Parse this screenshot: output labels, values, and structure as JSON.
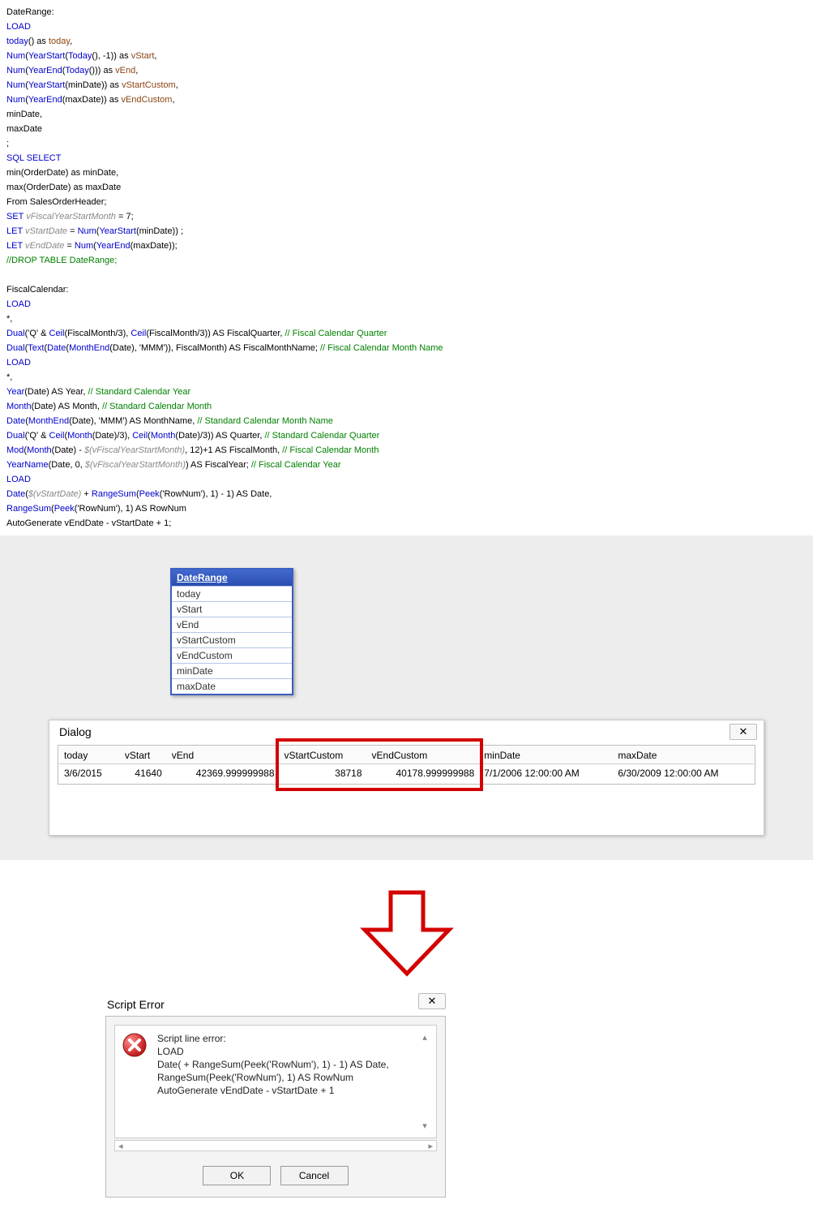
{
  "code": {
    "lines": [
      {
        "parts": [
          {
            "t": "DateRange:",
            "c": "c-black"
          }
        ]
      },
      {
        "parts": [
          {
            "t": "LOAD",
            "c": "c-blue"
          }
        ]
      },
      {
        "parts": [
          {
            "t": "today",
            "c": "c-blue"
          },
          {
            "t": "() as ",
            "c": "c-black"
          },
          {
            "t": "today",
            "c": "c-brown"
          },
          {
            "t": ",",
            "c": "c-black"
          }
        ]
      },
      {
        "parts": [
          {
            "t": "Num",
            "c": "c-blue"
          },
          {
            "t": "(",
            "c": "c-black"
          },
          {
            "t": "YearStart",
            "c": "c-blue"
          },
          {
            "t": "(",
            "c": "c-black"
          },
          {
            "t": "Today",
            "c": "c-blue"
          },
          {
            "t": "(), -1)) as ",
            "c": "c-black"
          },
          {
            "t": "vStart",
            "c": "c-brown"
          },
          {
            "t": ",",
            "c": "c-black"
          }
        ]
      },
      {
        "parts": [
          {
            "t": " Num",
            "c": "c-blue"
          },
          {
            "t": "(",
            "c": "c-black"
          },
          {
            "t": "YearEnd",
            "c": "c-blue"
          },
          {
            "t": "(",
            "c": "c-black"
          },
          {
            "t": "Today",
            "c": "c-blue"
          },
          {
            "t": "())) as ",
            "c": "c-black"
          },
          {
            "t": "vEnd",
            "c": "c-brown"
          },
          {
            "t": ",",
            "c": "c-black"
          }
        ]
      },
      {
        "parts": [
          {
            "t": "Num",
            "c": "c-blue"
          },
          {
            "t": "(",
            "c": "c-black"
          },
          {
            "t": "YearStart",
            "c": "c-blue"
          },
          {
            "t": "(minDate)) as ",
            "c": "c-black"
          },
          {
            "t": "vStartCustom",
            "c": "c-brown"
          },
          {
            "t": ",",
            "c": "c-black"
          }
        ]
      },
      {
        "parts": [
          {
            "t": "Num",
            "c": "c-blue"
          },
          {
            "t": "(",
            "c": "c-black"
          },
          {
            "t": "YearEnd",
            "c": "c-blue"
          },
          {
            "t": "(maxDate)) as ",
            "c": "c-black"
          },
          {
            "t": "vEndCustom",
            "c": "c-brown"
          },
          {
            "t": ",",
            "c": "c-black"
          }
        ]
      },
      {
        "parts": [
          {
            "t": " minDate,",
            "c": "c-black"
          }
        ]
      },
      {
        "parts": [
          {
            "t": " maxDate",
            "c": "c-black"
          }
        ]
      },
      {
        "parts": [
          {
            "t": ";",
            "c": "c-black"
          }
        ]
      },
      {
        "parts": [
          {
            "t": "SQL SELECT",
            "c": "c-blue"
          }
        ]
      },
      {
        "parts": [
          {
            "t": "min(OrderDate) as minDate,",
            "c": "c-black"
          }
        ]
      },
      {
        "parts": [
          {
            "t": "max(OrderDate) as maxDate",
            "c": "c-black"
          }
        ]
      },
      {
        "parts": [
          {
            "t": "From SalesOrderHeader;",
            "c": "c-black"
          }
        ]
      },
      {
        "parts": [
          {
            "t": "SET",
            "c": "c-blue"
          },
          {
            "t": " ",
            "c": "c-black"
          },
          {
            "t": "vFiscalYearStartMonth",
            "c": "c-ital"
          },
          {
            "t": " = 7;",
            "c": "c-black"
          }
        ]
      },
      {
        "parts": [
          {
            "t": "LET",
            "c": "c-blue"
          },
          {
            "t": " ",
            "c": "c-black"
          },
          {
            "t": "vStartDate",
            "c": "c-ital"
          },
          {
            "t": " = ",
            "c": "c-black"
          },
          {
            "t": "Num",
            "c": "c-blue"
          },
          {
            "t": "(",
            "c": "c-black"
          },
          {
            "t": "YearStart",
            "c": "c-blue"
          },
          {
            "t": "(minDate)) ;",
            "c": "c-black"
          }
        ]
      },
      {
        "parts": [
          {
            "t": "LET",
            "c": "c-blue"
          },
          {
            "t": " ",
            "c": "c-black"
          },
          {
            "t": "vEndDate",
            "c": "c-ital"
          },
          {
            "t": " =  ",
            "c": "c-black"
          },
          {
            "t": "Num",
            "c": "c-blue"
          },
          {
            "t": "(",
            "c": "c-black"
          },
          {
            "t": "YearEnd",
            "c": "c-blue"
          },
          {
            "t": "(maxDate));",
            "c": "c-black"
          }
        ]
      },
      {
        "parts": [
          {
            "t": "//DROP TABLE DateRange;",
            "c": "c-green"
          }
        ]
      },
      {
        "parts": [
          {
            "t": " ",
            "c": "c-black"
          }
        ]
      },
      {
        "parts": [
          {
            "t": "FiscalCalendar:",
            "c": "c-black"
          }
        ]
      },
      {
        "parts": [
          {
            "t": "LOAD",
            "c": "c-blue"
          }
        ]
      },
      {
        "parts": [
          {
            "t": "*,",
            "c": "c-black"
          }
        ]
      },
      {
        "parts": [
          {
            "t": "Dual",
            "c": "c-blue"
          },
          {
            "t": "('Q' & ",
            "c": "c-black"
          },
          {
            "t": "Ceil",
            "c": "c-blue"
          },
          {
            "t": "(FiscalMonth/3), ",
            "c": "c-black"
          },
          {
            "t": "Ceil",
            "c": "c-blue"
          },
          {
            "t": "(FiscalMonth/3)) AS FiscalQuarter, ",
            "c": "c-black"
          },
          {
            "t": "// Fiscal Calendar Quarter",
            "c": "c-green"
          }
        ]
      },
      {
        "parts": [
          {
            "t": "Dual",
            "c": "c-blue"
          },
          {
            "t": "(",
            "c": "c-black"
          },
          {
            "t": "Text",
            "c": "c-blue"
          },
          {
            "t": "(",
            "c": "c-black"
          },
          {
            "t": "Date",
            "c": "c-blue"
          },
          {
            "t": "(",
            "c": "c-black"
          },
          {
            "t": "MonthEnd",
            "c": "c-blue"
          },
          {
            "t": "(Date), 'MMM')), FiscalMonth) AS FiscalMonthName; ",
            "c": "c-black"
          },
          {
            "t": "// Fiscal Calendar Month Name",
            "c": "c-green"
          }
        ]
      },
      {
        "parts": [
          {
            "t": "LOAD",
            "c": "c-blue"
          }
        ]
      },
      {
        "parts": [
          {
            "t": "*,",
            "c": "c-black"
          }
        ]
      },
      {
        "parts": [
          {
            "t": "Year",
            "c": "c-blue"
          },
          {
            "t": "(Date) AS Year, ",
            "c": "c-black"
          },
          {
            "t": "// Standard Calendar Year",
            "c": "c-green"
          }
        ]
      },
      {
        "parts": [
          {
            "t": "Month",
            "c": "c-blue"
          },
          {
            "t": "(Date) AS Month, ",
            "c": "c-black"
          },
          {
            "t": "// Standard Calendar Month",
            "c": "c-green"
          }
        ]
      },
      {
        "parts": [
          {
            "t": "Date",
            "c": "c-blue"
          },
          {
            "t": "(",
            "c": "c-black"
          },
          {
            "t": "MonthEnd",
            "c": "c-blue"
          },
          {
            "t": "(Date), 'MMM') AS MonthName,  ",
            "c": "c-black"
          },
          {
            "t": "// Standard Calendar Month Name",
            "c": "c-green"
          }
        ]
      },
      {
        "parts": [
          {
            "t": "Dual",
            "c": "c-blue"
          },
          {
            "t": "('Q' & ",
            "c": "c-black"
          },
          {
            "t": "Ceil",
            "c": "c-blue"
          },
          {
            "t": "(",
            "c": "c-black"
          },
          {
            "t": "Month",
            "c": "c-blue"
          },
          {
            "t": "(Date)/3), ",
            "c": "c-black"
          },
          {
            "t": "Ceil",
            "c": "c-blue"
          },
          {
            "t": "(",
            "c": "c-black"
          },
          {
            "t": "Month",
            "c": "c-blue"
          },
          {
            "t": "(Date)/3)) AS Quarter,  ",
            "c": "c-black"
          },
          {
            "t": "// Standard Calendar Quarter",
            "c": "c-green"
          }
        ]
      },
      {
        "parts": [
          {
            "t": "Mod",
            "c": "c-blue"
          },
          {
            "t": "(",
            "c": "c-black"
          },
          {
            "t": "Month",
            "c": "c-blue"
          },
          {
            "t": "(Date) - ",
            "c": "c-black"
          },
          {
            "t": "$(vFiscalYearStartMonth)",
            "c": "c-ital"
          },
          {
            "t": ", 12)+1 AS FiscalMonth,  ",
            "c": "c-black"
          },
          {
            "t": "// Fiscal Calendar Month",
            "c": "c-green"
          }
        ]
      },
      {
        "parts": [
          {
            "t": "YearName",
            "c": "c-blue"
          },
          {
            "t": "(Date, 0, ",
            "c": "c-black"
          },
          {
            "t": "$(vFiscalYearStartMonth)",
            "c": "c-ital"
          },
          {
            "t": ") AS FiscalYear;  ",
            "c": "c-black"
          },
          {
            "t": "// Fiscal Calendar Year",
            "c": "c-green"
          }
        ]
      },
      {
        "parts": [
          {
            "t": "LOAD",
            "c": "c-blue"
          }
        ]
      },
      {
        "parts": [
          {
            "t": "Date",
            "c": "c-blue"
          },
          {
            "t": "(",
            "c": "c-black"
          },
          {
            "t": "$(vStartDate)",
            "c": "c-ital"
          },
          {
            "t": " + ",
            "c": "c-black"
          },
          {
            "t": "RangeSum",
            "c": "c-blue"
          },
          {
            "t": "(",
            "c": "c-black"
          },
          {
            "t": "Peek",
            "c": "c-blue"
          },
          {
            "t": "('RowNum'), 1) - 1) AS Date,",
            "c": "c-black"
          }
        ]
      },
      {
        "parts": [
          {
            "t": "RangeSum",
            "c": "c-blue"
          },
          {
            "t": "(",
            "c": "c-black"
          },
          {
            "t": "Peek",
            "c": "c-blue"
          },
          {
            "t": "('RowNum'), 1) AS RowNum",
            "c": "c-black"
          }
        ]
      },
      {
        "parts": [
          {
            "t": "AutoGenerate vEndDate - vStartDate + 1;",
            "c": "c-black"
          }
        ]
      }
    ]
  },
  "dr_box": {
    "title": "DateRange",
    "rows": [
      "today",
      "vStart",
      "vEnd",
      "vStartCustom",
      "vEndCustom",
      "minDate",
      "maxDate"
    ]
  },
  "dialog": {
    "title": "Dialog",
    "close": "✕",
    "headers": [
      "today",
      "vStart",
      "vEnd",
      "vStartCustom",
      "vEndCustom",
      "minDate",
      "maxDate"
    ],
    "row": [
      "3/6/2015",
      "41640",
      "42369.999999988",
      "38718",
      "40178.999999988",
      "7/1/2006 12:00:00 AM",
      "6/30/2009 12:00:00 AM"
    ]
  },
  "error": {
    "title": "Script Error",
    "close": "✕",
    "lines": [
      "Script line error:",
      "LOAD",
      "Date( + RangeSum(Peek('RowNum'), 1) - 1) AS Date,",
      "RangeSum(Peek('RowNum'), 1) AS RowNum",
      "AutoGenerate vEndDate - vStartDate + 1"
    ],
    "ok": "OK",
    "cancel": "Cancel"
  }
}
